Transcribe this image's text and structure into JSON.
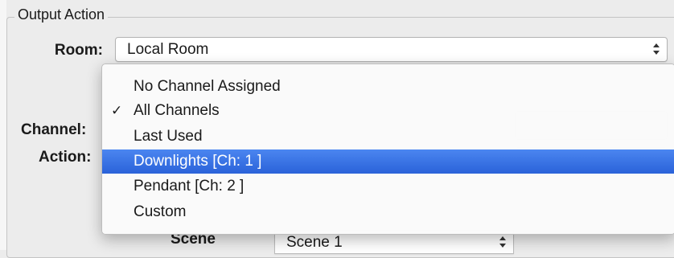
{
  "group": {
    "title": "Output Action"
  },
  "fields": {
    "room": {
      "label": "Room:",
      "value": "Local Room"
    },
    "channel": {
      "label": "Channel:"
    },
    "action": {
      "label": "Action:"
    },
    "scene": {
      "label": "Scene",
      "value": "Scene 1"
    }
  },
  "channel_menu": {
    "items": [
      {
        "label": "No Channel Assigned",
        "checked": false,
        "highlighted": false
      },
      {
        "label": "All Channels",
        "checked": true,
        "highlighted": false,
        "check_glyph": "✓"
      },
      {
        "label": "Last Used",
        "checked": false,
        "highlighted": false
      },
      {
        "label": "Downlights [Ch: 1 ]",
        "checked": false,
        "highlighted": true
      },
      {
        "label": "Pendant [Ch: 2 ]",
        "checked": false,
        "highlighted": false
      },
      {
        "label": "Custom",
        "checked": false,
        "highlighted": false
      }
    ]
  },
  "colors": {
    "highlight": "#2f6ce0",
    "group_border": "#c4c4c4"
  }
}
